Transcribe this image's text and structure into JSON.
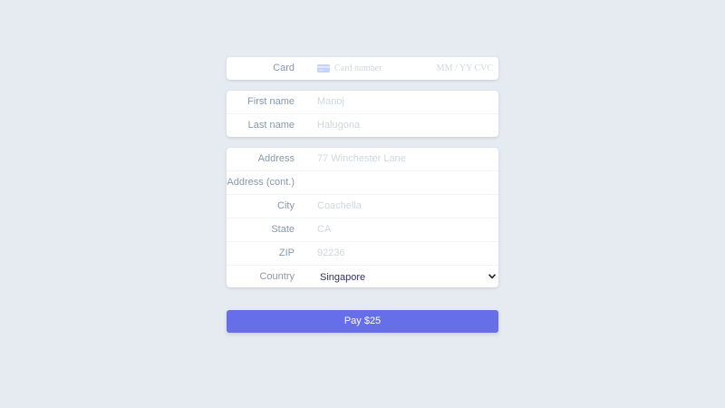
{
  "card": {
    "label": "Card",
    "icon": "credit-card-icon",
    "number_placeholder": "Card number",
    "exp_cvc_placeholder": "MM / YY  CVC"
  },
  "name": {
    "first_label": "First name",
    "first_placeholder": "Manoj",
    "last_label": "Last name",
    "last_placeholder": "Halugona"
  },
  "address": {
    "address_label": "Address",
    "address_placeholder": "77 Winchester Lane",
    "address2_label": "Address (cont.)",
    "address2_placeholder": "",
    "city_label": "City",
    "city_placeholder": "Coachella",
    "state_label": "State",
    "state_placeholder": "CA",
    "zip_label": "ZIP",
    "zip_placeholder": "92236",
    "country_label": "Country",
    "country_value": "Singapore"
  },
  "pay_button": {
    "label": "Pay $25"
  },
  "colors": {
    "background": "#e6ebf1",
    "accent": "#666ee8",
    "label": "#8898aa",
    "placeholder": "#cfd7df",
    "text": "#32325d"
  }
}
